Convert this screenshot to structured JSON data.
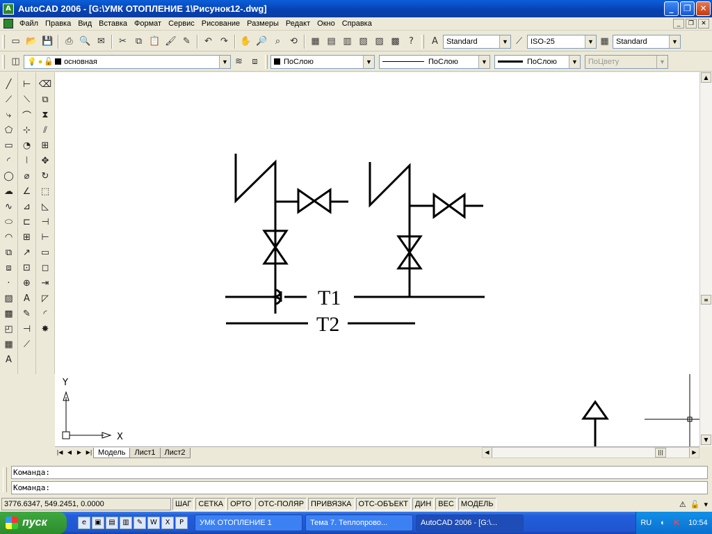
{
  "window": {
    "title": "AutoCAD 2006 - [G:\\УМК ОТОПЛЕНИЕ 1\\Рисунок12-.dwg]",
    "minimize": "_",
    "maximize": "❐",
    "close": "✕"
  },
  "menu": {
    "items": [
      "Файл",
      "Правка",
      "Вид",
      "Вставка",
      "Формат",
      "Сервис",
      "Рисование",
      "Размеры",
      "Редакт",
      "Окно",
      "Справка"
    ]
  },
  "toolbar": {
    "text_style": "Standard",
    "dim_style": "ISO-25",
    "table_style": "Standard"
  },
  "layers": {
    "current_layer": "основная",
    "color": "ПоСлою",
    "linetype": "ПоСлою",
    "lineweight": "ПоСлою",
    "plotstyle": "ПоЦвету"
  },
  "drawing": {
    "label_t1": "T1",
    "label_t2": "T2",
    "axis_y": "Y",
    "axis_x": "X"
  },
  "tabs": [
    "Модель",
    "Лист1",
    "Лист2"
  ],
  "command": {
    "line1": "Команда:",
    "line2": "Команда:"
  },
  "status": {
    "coords": "3776.6347, 549.2451, 0.0000",
    "buttons": [
      "ШАГ",
      "СЕТКА",
      "ОРТО",
      "ОТС-ПОЛЯР",
      "ПРИВЯЗКА",
      "ОТС-ОБЪЕКТ",
      "ДИН",
      "ВЕС",
      "МОДЕЛЬ"
    ]
  },
  "taskbar": {
    "start": "пуск",
    "tasks": [
      "УМК ОТОПЛЕНИЕ 1",
      "Тема 7. Теплопрово...",
      "AutoCAD 2006 - [G:\\..."
    ],
    "lang": "RU",
    "time": "10:54"
  }
}
